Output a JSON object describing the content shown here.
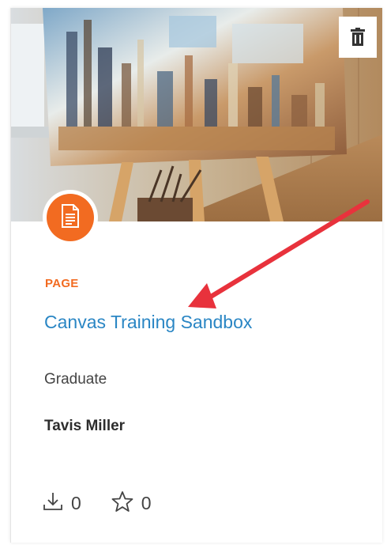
{
  "colors": {
    "accent_orange": "#f26b21",
    "title_blue": "#2a86c4",
    "annotation_red": "#e8323c"
  },
  "icons": {
    "delete": "trash-icon",
    "type": "document-icon",
    "downloads": "download-icon",
    "favorites": "star-icon"
  },
  "card": {
    "resource_type": "PAGE",
    "title": "Canvas Training Sandbox",
    "level": "Graduate",
    "author": "Tavis Miller",
    "downloads_count": "0",
    "favorites_count": "0"
  }
}
